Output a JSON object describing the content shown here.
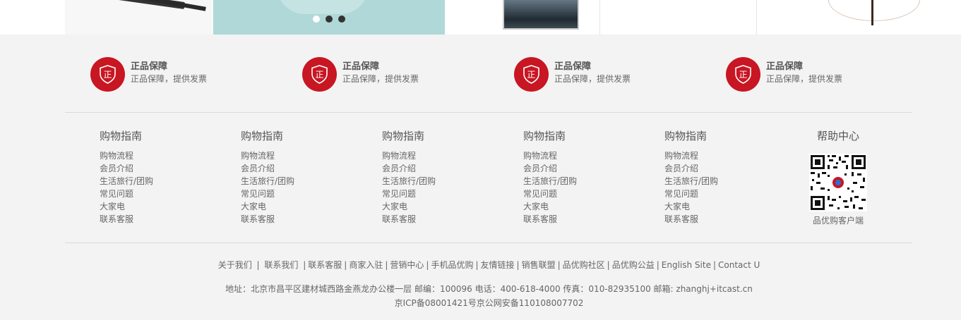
{
  "colors": {
    "brand_red": "#c81623",
    "footer_bg": "#f3f3f3",
    "text": "#666666"
  },
  "promises": [
    {
      "icon": "shield-zheng-icon",
      "title": "正品保障",
      "desc": "正品保障，提供发票"
    },
    {
      "icon": "shield-zheng-icon",
      "title": "正品保障",
      "desc": "正品保障，提供发票"
    },
    {
      "icon": "shield-zheng-icon",
      "title": "正品保障",
      "desc": "正品保障，提供发票"
    },
    {
      "icon": "shield-zheng-icon",
      "title": "正品保障",
      "desc": "正品保障，提供发票"
    }
  ],
  "badge_glyph": "正",
  "guides": [
    {
      "title": "购物指南",
      "items": [
        "购物流程",
        "会员介绍",
        "生活旅行/团购",
        "常见问题",
        "大家电",
        "联系客服"
      ]
    },
    {
      "title": "购物指南",
      "items": [
        "购物流程",
        "会员介绍",
        "生活旅行/团购",
        "常见问题",
        "大家电",
        "联系客服"
      ]
    },
    {
      "title": "购物指南",
      "items": [
        "购物流程",
        "会员介绍",
        "生活旅行/团购",
        "常见问题",
        "大家电",
        "联系客服"
      ]
    },
    {
      "title": "购物指南",
      "items": [
        "购物流程",
        "会员介绍",
        "生活旅行/团购",
        "常见问题",
        "大家电",
        "联系客服"
      ]
    },
    {
      "title": "购物指南",
      "items": [
        "购物流程",
        "会员介绍",
        "生活旅行/团购",
        "常见问题",
        "大家电",
        "联系客服"
      ]
    }
  ],
  "help": {
    "title": "帮助中心",
    "qr_caption": "品优购客户端"
  },
  "footer_links": [
    "关于我们",
    "联系我们",
    "联系客服",
    "商家入驻",
    "营销中心",
    "手机品优购",
    "友情链接",
    "销售联盟",
    "品优购社区",
    "品优购公益",
    "English Site",
    "Contact U"
  ],
  "address": "地址：北京市昌平区建材城西路金燕龙办公楼一层 邮编：100096 电话：400-618-4000 传真：010-82935100 邮箱: zhanghj+itcast.cn",
  "icp": "京ICP备08001421号京公网安备110108007702"
}
